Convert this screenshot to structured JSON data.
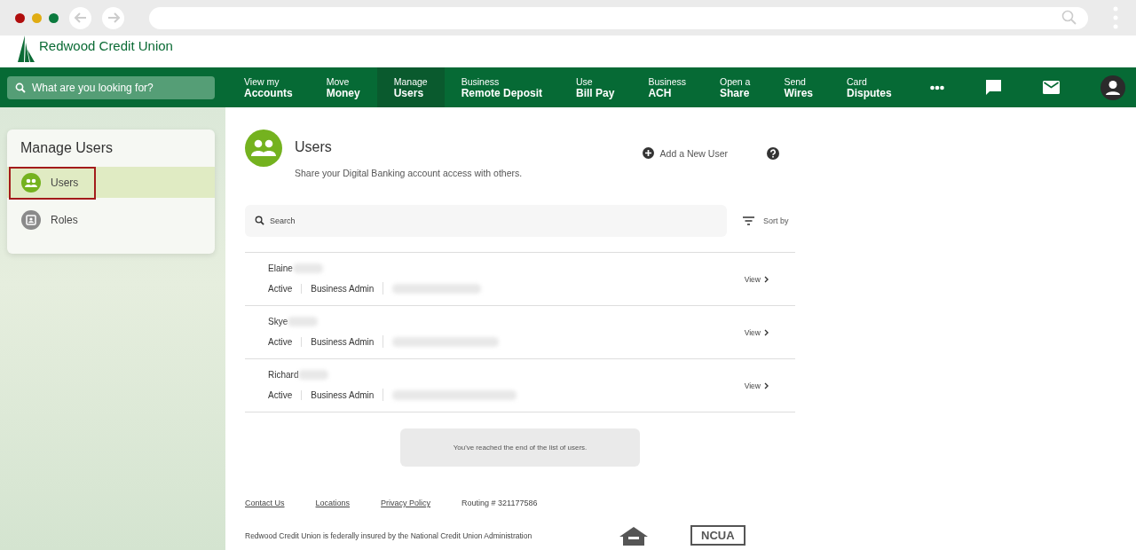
{
  "brand": {
    "name": "Redwood Credit Union"
  },
  "nav": {
    "search_placeholder": "What are you looking for?",
    "items": [
      {
        "top": "View my",
        "bottom": "Accounts",
        "selected": false
      },
      {
        "top": "Move",
        "bottom": "Money",
        "selected": false
      },
      {
        "top": "Manage",
        "bottom": "Users",
        "selected": true
      },
      {
        "top": "Business",
        "bottom": "Remote Deposit",
        "selected": false
      },
      {
        "top": "Use",
        "bottom": "Bill Pay",
        "selected": false
      },
      {
        "top": "Business",
        "bottom": "ACH",
        "selected": false
      },
      {
        "top": "Open a",
        "bottom": "Share",
        "selected": false
      },
      {
        "top": "Send",
        "bottom": "Wires",
        "selected": false
      },
      {
        "top": "Card",
        "bottom": "Disputes",
        "selected": false
      }
    ]
  },
  "sidebar": {
    "title": "Manage Users",
    "items": [
      {
        "label": "Users",
        "kind": "users",
        "selected": true,
        "highlighted": true
      },
      {
        "label": "Roles",
        "kind": "roles",
        "selected": false,
        "highlighted": false
      }
    ]
  },
  "page": {
    "title": "Users",
    "subtitle": "Share your Digital Banking account access with others.",
    "add_user": "Add a New User",
    "search_placeholder": "Search",
    "sort": "Sort by"
  },
  "users": [
    {
      "first_name": "Elaine",
      "status": "Active",
      "role": "Business Admin",
      "action": "View"
    },
    {
      "first_name": "Skye",
      "status": "Active",
      "role": "Business Admin",
      "action": "View"
    },
    {
      "first_name": "Richard",
      "status": "Active",
      "role": "Business Admin",
      "action": "View"
    }
  ],
  "end_message": "You've reached the end of the list of users.",
  "footer": {
    "links": [
      "Contact Us",
      "Locations",
      "Privacy Policy"
    ],
    "routing": "Routing # 321177586",
    "disclaimer": "Redwood Credit Union is federally insured by the National Credit Union Administration",
    "ncua": "NCUA"
  }
}
